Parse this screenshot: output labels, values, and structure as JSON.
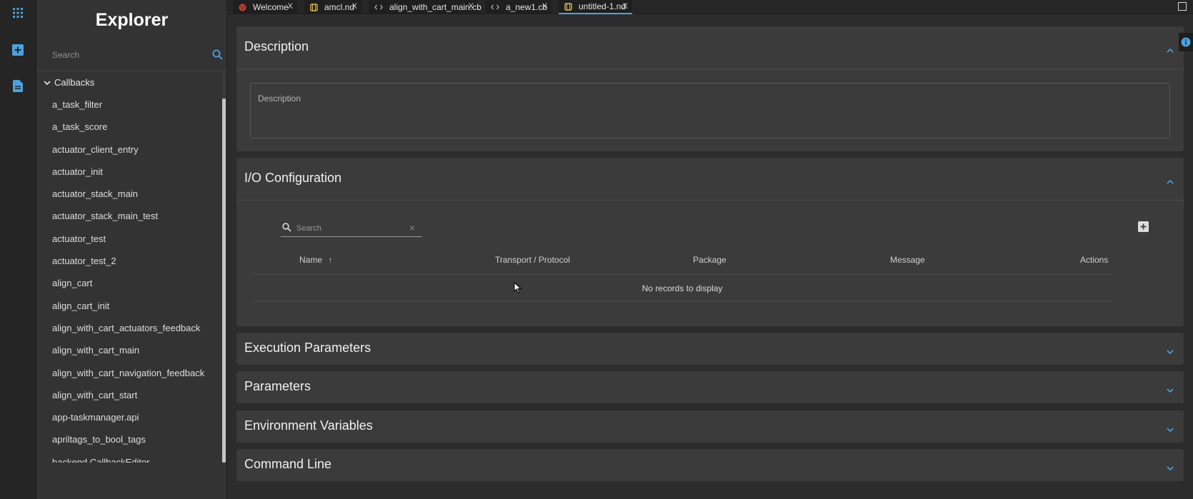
{
  "sidebar": {
    "title": "Explorer",
    "search_placeholder": "Search",
    "section_label": "Callbacks",
    "items": [
      "a_task_filter",
      "a_task_score",
      "actuator_client_entry",
      "actuator_init",
      "actuator_stack_main",
      "actuator_stack_main_test",
      "actuator_test",
      "actuator_test_2",
      "align_cart",
      "align_cart_init",
      "align_with_cart_actuators_feedback",
      "align_with_cart_main",
      "align_with_cart_navigation_feedback",
      "align_with_cart_start",
      "app-taskmanager.api",
      "apriltags_to_bool_tags",
      "backend.CallbackEditor"
    ]
  },
  "tabs": [
    {
      "label": "Welcome",
      "close": "X",
      "icon": "ros-logo-icon"
    },
    {
      "label": "amcl.nd",
      "close": "X",
      "icon": "node-file-icon"
    },
    {
      "label": "align_with_cart_main.cb",
      "close": "X",
      "icon": "code-file-icon"
    },
    {
      "label": "a_new1.cb",
      "close": "X",
      "icon": "code-file-icon"
    },
    {
      "label": "untitled-1.nd",
      "close": "X",
      "icon": "node-file-icon",
      "active": true
    }
  ],
  "colors": {
    "accent": "#4aa3df",
    "node_icon": "#e2c14f",
    "ros_icon": "#d13b2f"
  },
  "description": {
    "title": "Description",
    "field_label": "Description"
  },
  "io": {
    "title": "I/O Configuration",
    "search_placeholder": "Search",
    "clear": "×",
    "columns": {
      "name": "Name",
      "name_sort": "↑",
      "transport": "Transport / Protocol",
      "package": "Package",
      "message": "Message",
      "actions": "Actions"
    },
    "empty_text": "No records to display"
  },
  "sections": {
    "execution": "Execution Parameters",
    "parameters": "Parameters",
    "environment": "Environment Variables",
    "command_line": "Command Line"
  }
}
